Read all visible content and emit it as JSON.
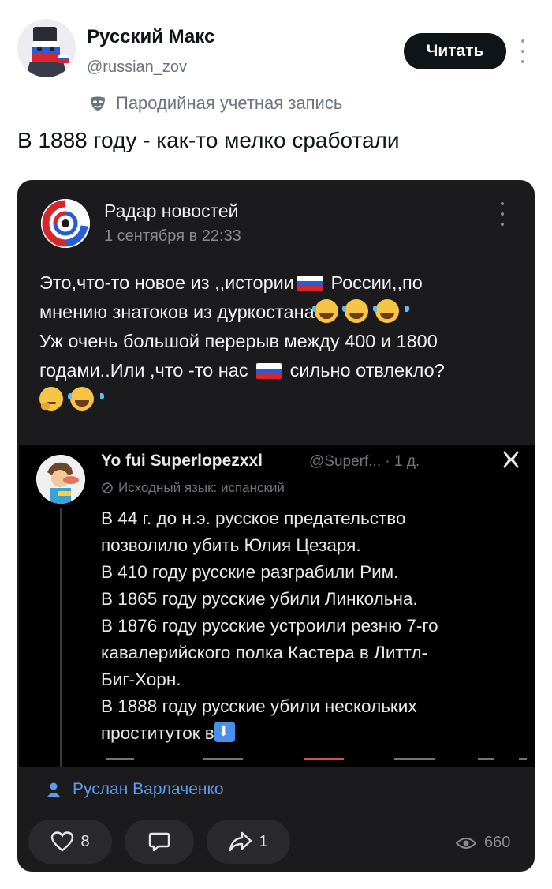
{
  "header": {
    "display_name": "Русский Макс",
    "handle": "@russian_zov",
    "follow_label": "Читать",
    "parody_label": "Пародийная учетная запись"
  },
  "tweet": {
    "text": "В 1888 году - как-то мелко сработали"
  },
  "card": {
    "source_name": "Радар новостей",
    "date": "1 сентября в 22:33",
    "body_lines": [
      "Это,что-то новое из ,,истории",
      " России,,по",
      "мнению знатоков  из дуркостана",
      "Уж очень большой перерыв между 400 и 1800",
      "годами..Или ,что -то нас ",
      " сильно отвлекло?"
    ],
    "embedded": {
      "name": "Yo fui Superlopezxxl",
      "meta": "@Superf... · 1 д.",
      "language_note": "Исходный язык: испанский",
      "lines": [
        "В 44 г. до н.э. русское предательство",
        "позволило убить Юлия Цезаря.",
        "В 410 году русские разграбили Рим.",
        "В 1865 году русские убили Линкольна.",
        "В 1876 году русские устроили резню 7-го",
        "кавалерийского полка Кастера в Литтл-",
        "Биг-Хорн.",
        "В 1888 году русские убили нескольких",
        "проституток в"
      ]
    },
    "reposter": "Руслан Варлаченко",
    "actions": {
      "likes": "8",
      "reposts": "1",
      "views": "660"
    }
  },
  "colors": {
    "card_bg": "#1b1b1d",
    "link_blue": "#5b9bf0",
    "follow_bg": "#0f1419"
  },
  "icons": [
    "mask-icon",
    "kebab-icon",
    "heart-icon",
    "comment-icon",
    "share-icon",
    "eye-icon",
    "user-icon",
    "x-logo",
    "translate-icon"
  ]
}
